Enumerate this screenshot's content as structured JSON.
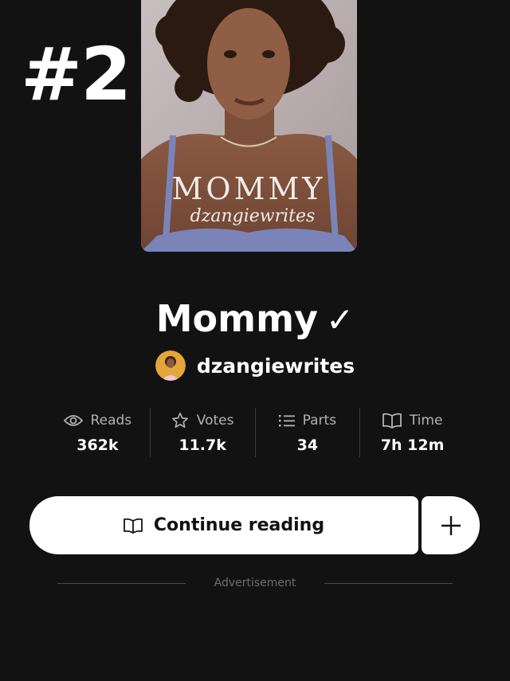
{
  "overlay": {
    "rank": "#2"
  },
  "cover": {
    "title_text": "MOMMY",
    "author_script": "dzangiewrites"
  },
  "story": {
    "title": "Mommy",
    "completed_mark": "✓"
  },
  "author": {
    "name": "dzangiewrites",
    "avatar": "author-avatar"
  },
  "stats": [
    {
      "label": "Reads",
      "value": "362k",
      "icon": "eye-icon"
    },
    {
      "label": "Votes",
      "value": "11.7k",
      "icon": "star-icon"
    },
    {
      "label": "Parts",
      "value": "34",
      "icon": "list-icon"
    },
    {
      "label": "Time",
      "value": "7h 12m",
      "icon": "book-icon"
    }
  ],
  "actions": {
    "continue_label": "Continue reading",
    "add_icon": "plus-icon"
  },
  "ad": {
    "label": "Advertisement"
  },
  "colors": {
    "background": "#121212",
    "button_bg": "#ffffff",
    "muted_text": "#b3b3b3"
  }
}
